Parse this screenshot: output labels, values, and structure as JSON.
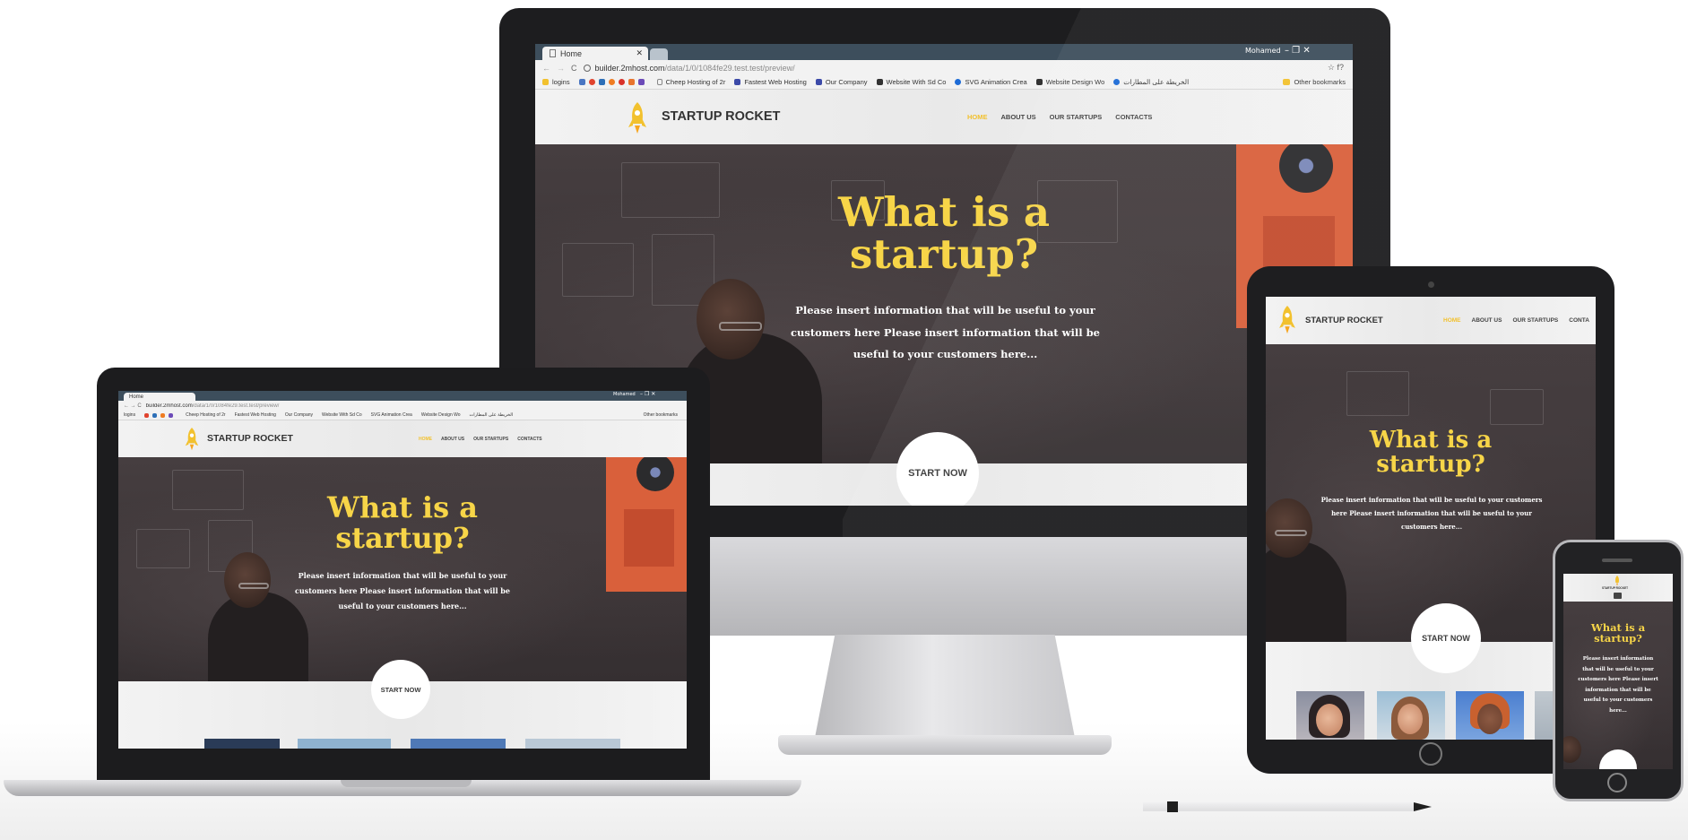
{
  "browser": {
    "tab_title": "Home",
    "user_name": "Mohamed",
    "url_host": "builder.2mhost.com",
    "url_path": "/data/1/0/1084fe29.test.test/preview/",
    "win_controls": "–  ❐  ✕",
    "addr_right": "☆  f?",
    "bookmarks": [
      "logins",
      "Cheep Hosting of 2r",
      "Fastest Web Hosting",
      "Our Company",
      "Website With Sd Co",
      "SVG Animation Crea",
      "Website Design Wo",
      "الخريطة على المطارات"
    ],
    "other_bookmarks": "Other bookmarks"
  },
  "site": {
    "brand": "STARTUP ROCKET",
    "menu": [
      "HOME",
      "ABOUT US",
      "OUR STARTUPS",
      "CONTACTS"
    ],
    "tablet_menu": [
      "HOME",
      "ABOUT US",
      "OUR STARTUPS",
      "CONTA"
    ],
    "hero_title_line1": "What is a",
    "hero_title_line2": "startup?",
    "hero_text": "Please insert information that will be useful to your customers here Please insert information that will be useful to your customers here...",
    "cta": "START NOW"
  },
  "colors": {
    "accent_yellow": "#f7d548",
    "active_menu": "#f2c12e",
    "hero_bg": "#3a3436",
    "nav_bg": "#f0f0f0",
    "chrome_tabbar": "#3d4e5c"
  },
  "icons": {
    "rocket": "rocket-logo-icon",
    "reload": "reload-icon",
    "back": "back-arrow-icon",
    "forward": "forward-arrow-icon",
    "info": "site-info-icon"
  }
}
